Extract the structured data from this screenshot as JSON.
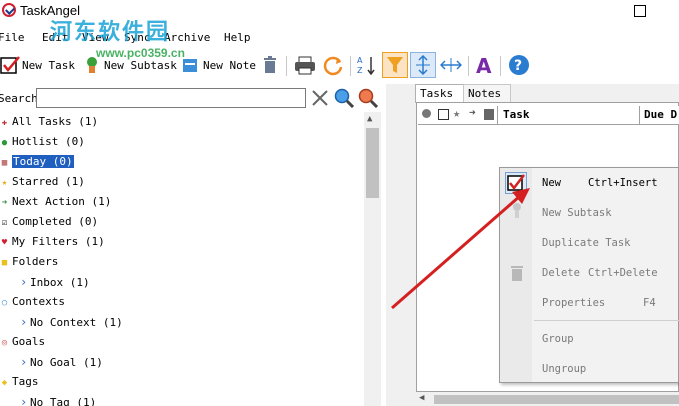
{
  "window": {
    "title": "TaskAngel"
  },
  "watermark": {
    "brand": "河东软件园",
    "url": "www.pc0359.cn"
  },
  "menubar": [
    "File",
    "Edit",
    "View",
    "Sync",
    "Archive",
    "Help"
  ],
  "toolbar": {
    "new_task": "New Task",
    "new_subtask": "New Subtask",
    "new_note": "New Note",
    "icons": [
      "delete-icon",
      "print-icon",
      "sync-icon",
      "sort-az-icon",
      "filter-icon",
      "expand-icon",
      "collapse-icon",
      "font-icon",
      "help-icon"
    ]
  },
  "search": {
    "label": "Search",
    "value": "",
    "placeholder": ""
  },
  "tree": [
    {
      "label": "All Tasks (1)",
      "icon": "all-tasks-icon"
    },
    {
      "label": "Hotlist (0)",
      "icon": "hotlist-icon"
    },
    {
      "label": "Today (0)",
      "icon": "today-icon",
      "selected": true
    },
    {
      "label": "Starred (1)",
      "icon": "star-icon"
    },
    {
      "label": "Next Action (1)",
      "icon": "next-action-icon"
    },
    {
      "label": "Completed (0)",
      "icon": "completed-icon"
    },
    {
      "label": "My Filters (1)",
      "icon": "heart-icon"
    },
    {
      "label": "Folders",
      "icon": "folder-icon"
    },
    {
      "label": "Inbox (1)",
      "child": true
    },
    {
      "label": "Contexts",
      "icon": "contexts-icon"
    },
    {
      "label": "No Context (1)",
      "child": true
    },
    {
      "label": "Goals",
      "icon": "goals-icon"
    },
    {
      "label": "No Goal (1)",
      "child": true
    },
    {
      "label": "Tags",
      "icon": "tag-icon"
    },
    {
      "label": "No Tag (1)",
      "child": true
    }
  ],
  "tabs": {
    "tasks": "Tasks",
    "notes": "Notes"
  },
  "grid": {
    "task_col": "Task",
    "due_col": "Due D"
  },
  "context_menu": {
    "new": "New",
    "new_sc": "Ctrl+Insert",
    "new_subtask": "New Subtask",
    "duplicate": "Duplicate Task",
    "delete": "Delete",
    "delete_sc": "Ctrl+Delete",
    "properties": "Properties",
    "properties_sc": "F4",
    "group": "Group",
    "ungroup": "Ungroup"
  },
  "colors": {
    "accent_red": "#d42020",
    "selected_bg": "#1f5fbf",
    "filter_orange": "#f0a020"
  }
}
